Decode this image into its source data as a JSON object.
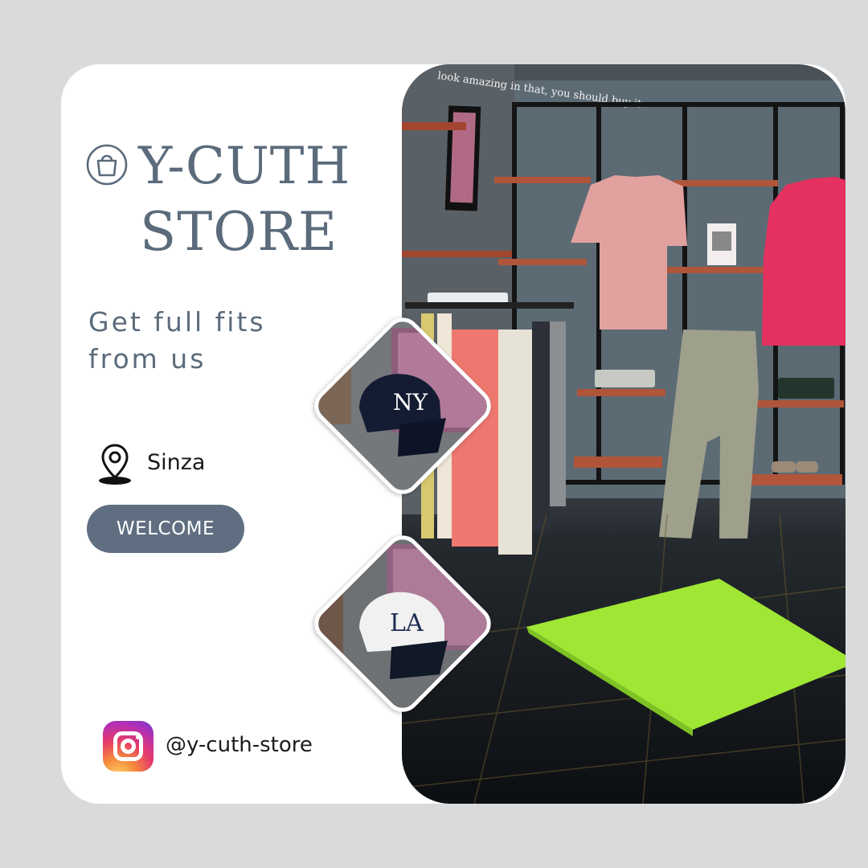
{
  "brand": {
    "title_line1": "Y-CUTH",
    "title_line2": "STORE",
    "icon": "shopping-bag-icon"
  },
  "tagline": "Get full fits from us",
  "location": {
    "icon": "map-pin-icon",
    "label": "Sinza"
  },
  "cta": {
    "label": "WELCOME"
  },
  "social": {
    "icon": "instagram-icon",
    "handle": "@y-cuth-store"
  },
  "photos": {
    "store_wall_text": "look amazing in that, you should buy it",
    "cap_1": "NY",
    "cap_2": "LA"
  },
  "colors": {
    "background": "#d9dadb",
    "card": "#ffffff",
    "title": "#5b6b7b",
    "button": "#5f6f81",
    "floor_platform": "#9fe635"
  }
}
